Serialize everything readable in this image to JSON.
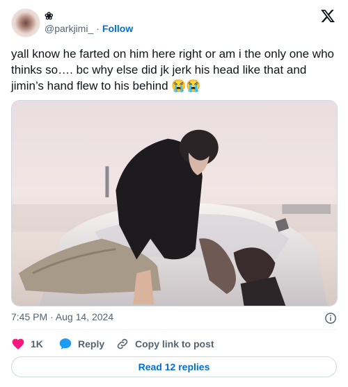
{
  "author": {
    "name": "❀",
    "handle": "@parkjimi_",
    "separator": "·",
    "follow_label": "Follow",
    "avatar_icon": "avatar"
  },
  "brand": {
    "logo_icon": "x-logo-icon"
  },
  "tweet": {
    "text": "yall know he farted on him here right or am i the only one who thinks so…. bc why else did jk jerk his head like that and jimin’s hand flew to his behind 😭😭",
    "timestamp": "7:45 PM · Aug 14, 2024"
  },
  "actions": {
    "like_count": "1K",
    "reply_label": "Reply",
    "copy_label": "Copy link to post"
  },
  "footer": {
    "read_replies_label": "Read 12 replies"
  },
  "colors": {
    "accent": "#006fd6",
    "like": "#f91880",
    "reply": "#1d9bf0",
    "muted": "#536471"
  }
}
